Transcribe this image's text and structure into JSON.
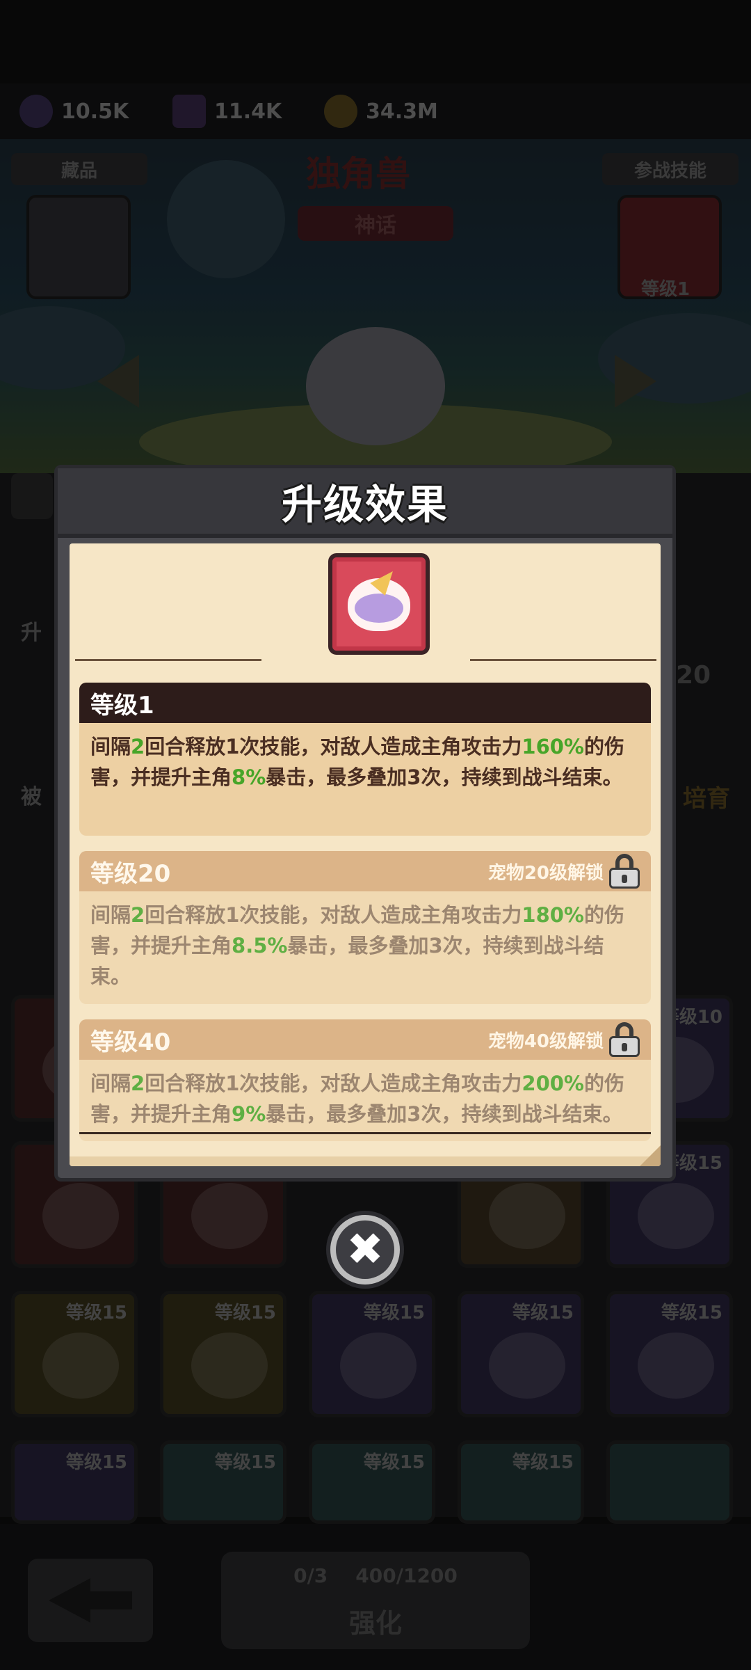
{
  "resources": [
    {
      "icon": "purple-potion-icon",
      "value": "10.5K"
    },
    {
      "icon": "purple-gem-icon",
      "value": "11.4K"
    },
    {
      "icon": "gold-coin-icon",
      "value": "34.3M"
    }
  ],
  "background": {
    "pet_name": "独角兽",
    "rarity": "神话",
    "collection_tab": "藏品",
    "battle_skill_tab": "参战技能",
    "skill_level": "等级1",
    "side_label_1": "升",
    "side_label_2": "被",
    "side_label_3": "培育",
    "badge_number": "20",
    "grid_levels": [
      "等级10",
      "等级15",
      "等级15",
      "等级15",
      "等级15",
      "等级15",
      "等级15",
      "等级15",
      "等级15",
      "等级15",
      "等级15"
    ],
    "cost_pets": "0/3",
    "cost_bones": "400/1200",
    "upgrade_label": "强化"
  },
  "modal": {
    "title": "升级效果",
    "levels": [
      {
        "name": "等级1",
        "locked": false,
        "desc_parts": [
          "间隔",
          "2",
          "回合释放1次技能，对敌人造成主角攻击力",
          "160%",
          "的伤害，并提升主角",
          "8%",
          "暴击，最多叠加3次，持续到战斗结束。"
        ]
      },
      {
        "name": "等级20",
        "locked": true,
        "unlock_text": "宠物20级解锁",
        "desc_parts": [
          "间隔",
          "2",
          "回合释放1次技能，对敌人造成主角攻击力",
          "180%",
          "的伤害，并提升主角",
          "8.5%",
          "暴击，最多叠加3次，持续到战斗结束。"
        ]
      },
      {
        "name": "等级40",
        "locked": true,
        "unlock_text": "宠物40级解锁",
        "desc_parts": [
          "间隔",
          "2",
          "回合释放1次技能，对敌人造成主角攻击力",
          "200%",
          "的伤害，并提升主角",
          "9%",
          "暴击，最多叠加3次，持续到战斗结束。"
        ]
      }
    ],
    "close_symbol": "✖"
  },
  "colors": {
    "highlight_green": "#47a529",
    "active_header": "#2d1c1a",
    "locked_header": "#dcb488",
    "parchment": "#f6e6c6"
  }
}
